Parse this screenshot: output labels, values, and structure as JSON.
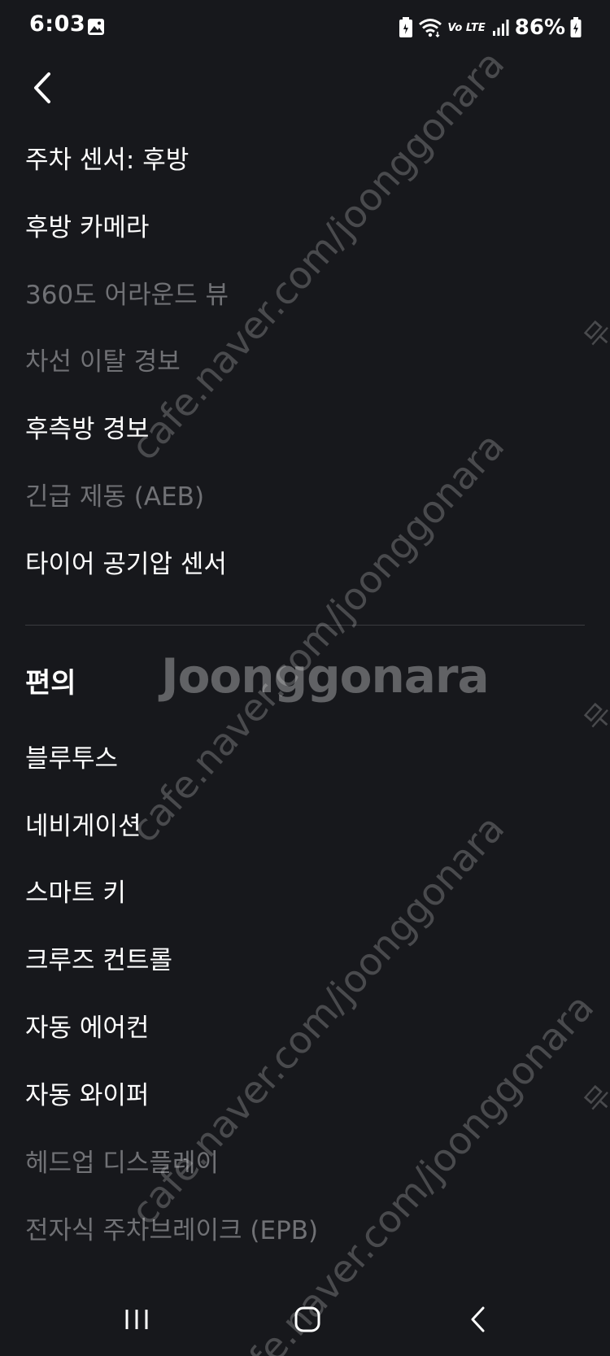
{
  "status_bar": {
    "time": "6:03",
    "network_label": "Vo LTE",
    "battery": "86%"
  },
  "menu": {
    "safety_items": [
      {
        "label": "주차 센서: 후방",
        "enabled": true
      },
      {
        "label": "후방 카메라",
        "enabled": true
      },
      {
        "label": "360도 어라운드 뷰",
        "enabled": false
      },
      {
        "label": "차선 이탈 경보",
        "enabled": false
      },
      {
        "label": "후측방 경보",
        "enabled": true
      },
      {
        "label": "긴급 제동 (AEB)",
        "enabled": false
      },
      {
        "label": "타이어 공기압 센서",
        "enabled": true
      }
    ],
    "convenience_title": "편의",
    "convenience_items": [
      {
        "label": "블루투스",
        "enabled": true
      },
      {
        "label": "네비게이션",
        "enabled": true
      },
      {
        "label": "스마트 키",
        "enabled": true
      },
      {
        "label": "크루즈 컨트롤",
        "enabled": true
      },
      {
        "label": "자동 에어컨",
        "enabled": true
      },
      {
        "label": "자동 와이퍼",
        "enabled": true
      },
      {
        "label": "헤드업 디스플레이",
        "enabled": false
      },
      {
        "label": "전자식 주차브레이크 (EPB)",
        "enabled": false
      }
    ]
  },
  "watermark": {
    "url_text": "cafe.naver.com/joonggonara",
    "logo_text": "Joonggonara",
    "edge_text": "무"
  },
  "colors": {
    "background": "#17181c",
    "enabled_text": "#ffffff",
    "disabled_text": "#707175",
    "divider": "#3a3b40"
  }
}
